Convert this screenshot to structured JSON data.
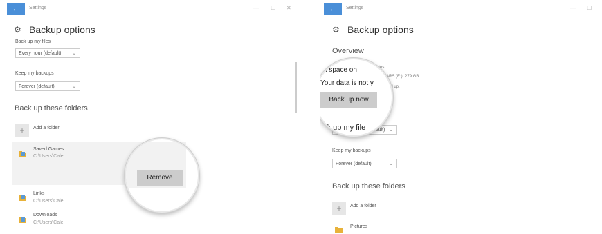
{
  "left": {
    "window_title": "Settings",
    "back_icon": "←",
    "minimize_icon": "—",
    "maximize_icon": "☐",
    "close_icon": "✕",
    "page_title": "Backup options",
    "backup_files": {
      "label": "Back up my files",
      "value": "Every hour (default)"
    },
    "keep_backups": {
      "label": "Keep my backups",
      "value": "Forever (default)"
    },
    "folders_title": "Back up these folders",
    "add_folder": "Add a folder",
    "folders": [
      {
        "name": "Saved Games",
        "path": "C:\\Users\\Cale"
      },
      {
        "name": "Links",
        "path": "C:\\Users\\Cale"
      },
      {
        "name": "Downloads",
        "path": "C:\\Users\\Cale"
      }
    ],
    "remove_button": "Remove"
  },
  "right": {
    "window_title": "Settings",
    "back_icon": "←",
    "minimize_icon": "—",
    "maximize_icon": "☐",
    "page_title": "Backup options",
    "overview_title": "Overview",
    "total_space_zoom": "tal space on",
    "total_space_tail": "0 bytes",
    "drive_text": "ARS (E:): 279 GB",
    "data_status_zoom": "Your data is not y",
    "data_status_tail": "ked up.",
    "backup_now_button": "Back up now",
    "backup_files_zoom": "ack up my file",
    "backup_files_value_tail": "default)",
    "keep_backups": {
      "label": "Keep my backups",
      "value": "Forever (default)"
    },
    "folders_title": "Back up these folders",
    "add_folder": "Add a folder",
    "folders": [
      {
        "name": "Pictures"
      }
    ]
  },
  "icons": {
    "gear": "⚙",
    "chevron": "⌄",
    "plus": "+"
  }
}
